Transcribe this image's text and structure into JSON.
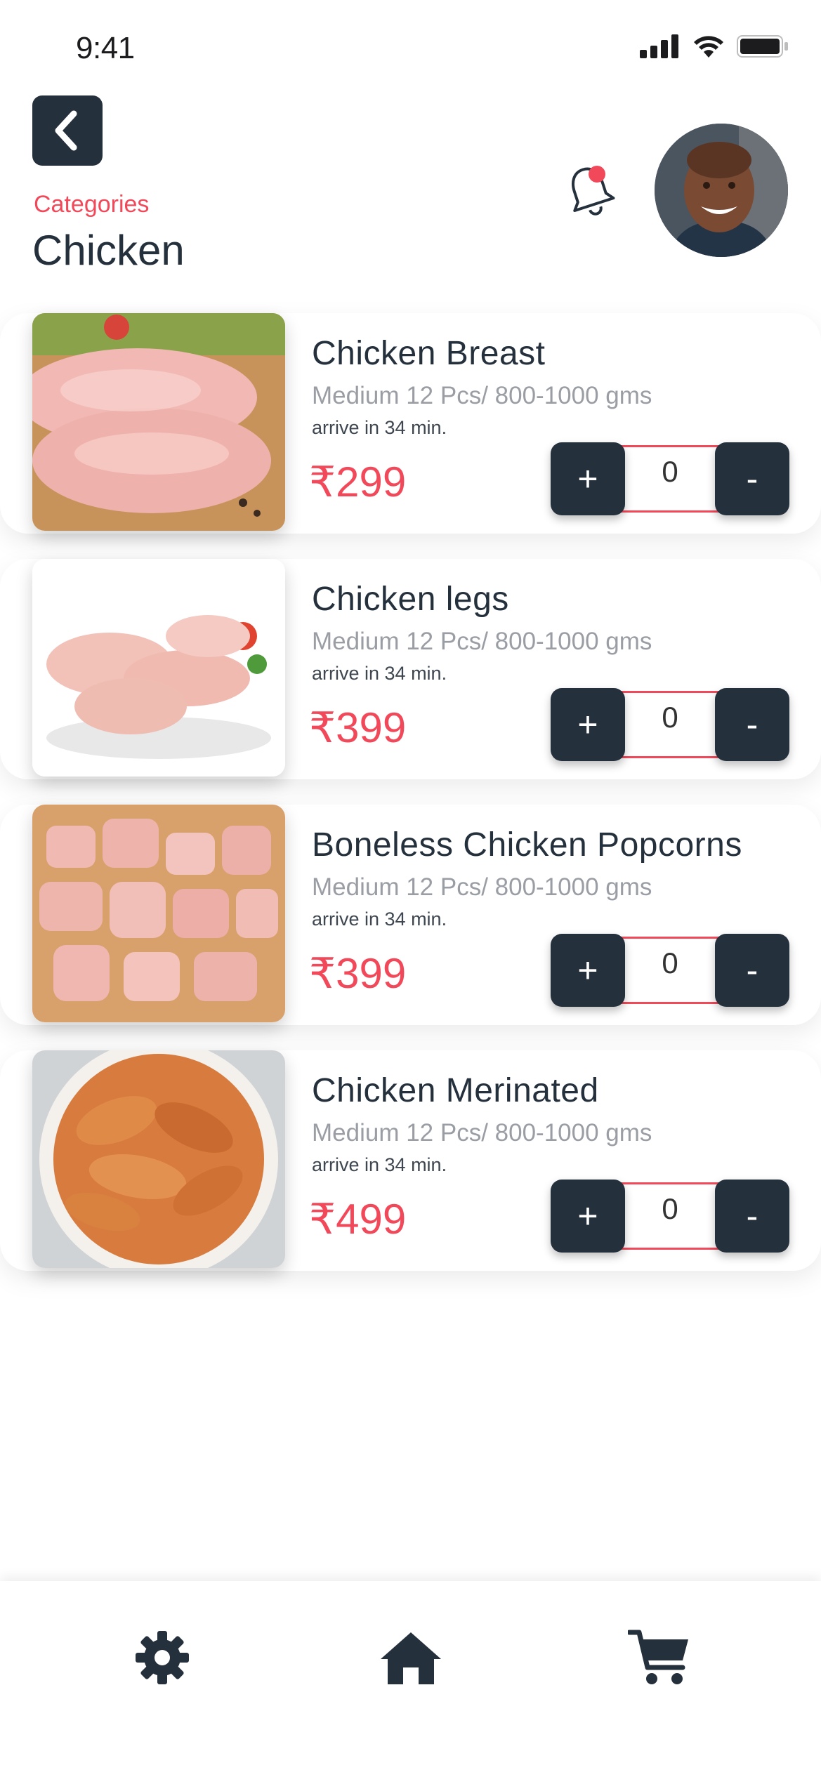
{
  "status_bar": {
    "time": "9:41"
  },
  "header": {
    "back_icon": "chevron-left-icon",
    "category_label": "Categories",
    "title": "Chicken",
    "bell_icon": "notification-bell-icon"
  },
  "colors": {
    "accent": "#f2495a",
    "dark": "#25303d",
    "muted": "#9a9ea4"
  },
  "products": [
    {
      "name": "Chicken Breast",
      "desc": "Medium 12 Pcs/ 800-1000 gms",
      "arrive": "arrive in 34 min.",
      "price": "₹299",
      "qty": "0",
      "plus": "+",
      "minus": "-"
    },
    {
      "name": "Chicken legs",
      "desc": "Medium 12 Pcs/ 800-1000 gms",
      "arrive": "arrive in 34 min.",
      "price": "₹399",
      "qty": "0",
      "plus": "+",
      "minus": "-"
    },
    {
      "name": "Boneless Chicken Popcorns",
      "desc": "Medium 12 Pcs/ 800-1000 gms",
      "arrive": "arrive in 34 min.",
      "price": "₹399",
      "qty": "0",
      "plus": "+",
      "minus": "-"
    },
    {
      "name": "Chicken Merinated",
      "desc": "Medium 12 Pcs/ 800-1000 gms",
      "arrive": "arrive in 34 min.",
      "price": "₹499",
      "qty": "0",
      "plus": "+",
      "minus": "-"
    }
  ],
  "bottom_nav": {
    "items": [
      {
        "icon": "settings-gear-icon"
      },
      {
        "icon": "home-icon"
      },
      {
        "icon": "cart-icon"
      }
    ]
  }
}
